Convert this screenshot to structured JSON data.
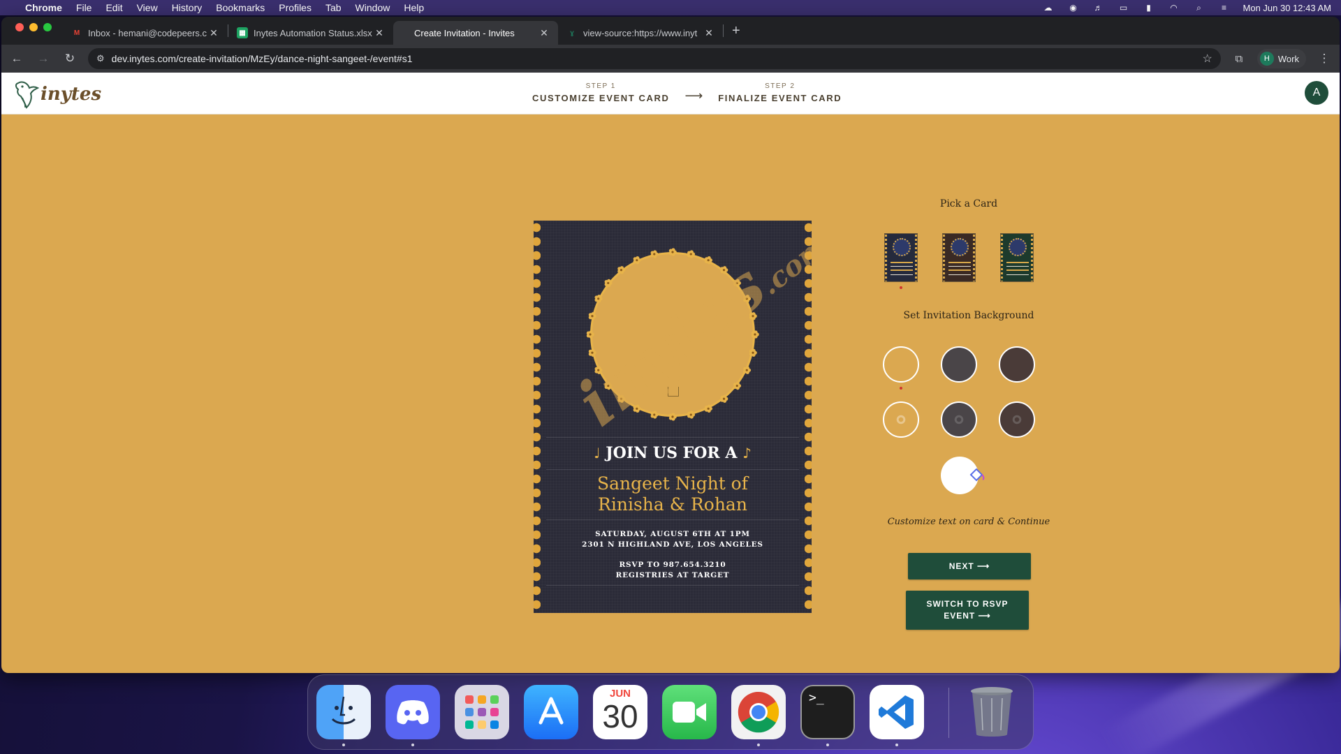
{
  "menubar": {
    "app": "Chrome",
    "items": [
      "File",
      "Edit",
      "View",
      "History",
      "Bookmarks",
      "Profiles",
      "Tab",
      "Window",
      "Help"
    ],
    "clock": "Mon Jun 30  12:43 AM"
  },
  "browser": {
    "tabs": [
      {
        "title": "Inbox - hemani@codepeers.c",
        "icon": "gmail-icon"
      },
      {
        "title": "Inytes Automation Status.xlsx",
        "icon": "sheets-icon"
      },
      {
        "title": "Create Invitation - Invites",
        "icon": "none",
        "active": true
      },
      {
        "title": "view-source:https://www.inyt",
        "icon": "inytes-icon"
      }
    ],
    "url": "dev.inytes.com/create-invitation/MzEy/dance-night-sangeet-/event#s1",
    "profile_initial": "H",
    "profile_name": "Work"
  },
  "site": {
    "logo_text": "inytes",
    "step1_small": "STEP 1",
    "step1_big": "CUSTOMIZE EVENT CARD",
    "step2_small": "STEP 2",
    "step2_big": "FINALIZE EVENT CARD",
    "arrow": "⟶",
    "user_initial": "A"
  },
  "card": {
    "join": "JOIN US FOR A",
    "headline_line1": "Sangeet Night of",
    "headline_line2": "Rinisha & Rohan",
    "date_line": "SATURDAY, AUGUST 6TH AT 1PM",
    "address_line": "2301 N HIGHLAND AVE, LOS ANGELES",
    "rsvp_line": "RSVP TO 987.654.3210",
    "registry_line": "REGISTRIES AT TARGET",
    "watermark": "inytes",
    "watermark_suffix": ".com",
    "background": "#2b2b38",
    "accent": "#e8b44a"
  },
  "panel": {
    "pick_card_title": "Pick a Card",
    "card_variants": [
      {
        "color": "#252a3c",
        "selected": true
      },
      {
        "color": "#3a2a24",
        "selected": false
      },
      {
        "color": "#1d3a2c",
        "selected": false
      }
    ],
    "background_title": "Set Invitation Background",
    "backgrounds": [
      {
        "color": "#dba850",
        "pattern": false,
        "selected": true
      },
      {
        "color": "#4a4548",
        "pattern": false,
        "selected": false
      },
      {
        "color": "#4a3b38",
        "pattern": false,
        "selected": false
      },
      {
        "color": "#dba850",
        "pattern": true,
        "selected": false
      },
      {
        "color": "#4a4548",
        "pattern": true,
        "selected": false
      },
      {
        "color": "#4a3b38",
        "pattern": true,
        "selected": false
      }
    ],
    "custom_text": "Customize text on card & Continue",
    "next_label": "NEXT ⟶",
    "switch_label_line1": "SWITCH TO RSVP",
    "switch_label_line2": "EVENT ⟶"
  },
  "dock": {
    "apps": [
      "finder-icon",
      "discord-icon",
      "launchpad-icon",
      "app-store-icon",
      "calendar-icon",
      "facetime-icon",
      "chrome-icon",
      "terminal-icon",
      "vscode-icon",
      "trash-icon"
    ],
    "calendar_month": "JUN",
    "calendar_day": "30"
  }
}
